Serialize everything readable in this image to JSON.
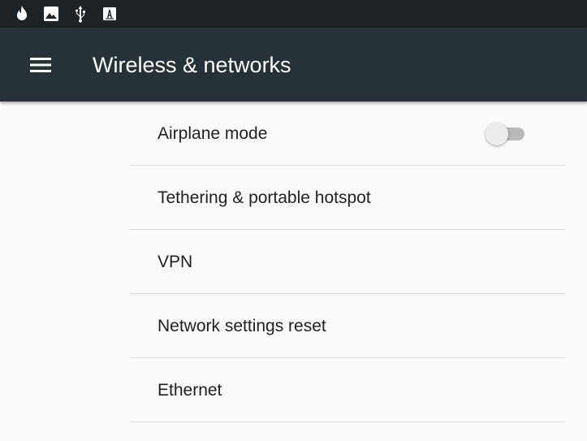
{
  "status_bar": {
    "icons": [
      "fire-icon",
      "image-icon",
      "usb-icon",
      "font-download-icon"
    ]
  },
  "app_bar": {
    "menu_icon": "menu-icon",
    "title": "Wireless & networks"
  },
  "settings": {
    "items": [
      {
        "label": "Airplane mode",
        "toggle": {
          "checked": false
        }
      },
      {
        "label": "Tethering & portable hotspot"
      },
      {
        "label": "VPN"
      },
      {
        "label": "Network settings reset"
      },
      {
        "label": "Ethernet"
      }
    ]
  },
  "colors": {
    "status_bar": "#1c2226",
    "app_bar": "#263238",
    "background": "#fafafa",
    "divider": "#dcdcdc",
    "text_primary": "#212121",
    "toggle_track_off": "#b9b9b9",
    "toggle_thumb_off": "#ececec"
  }
}
